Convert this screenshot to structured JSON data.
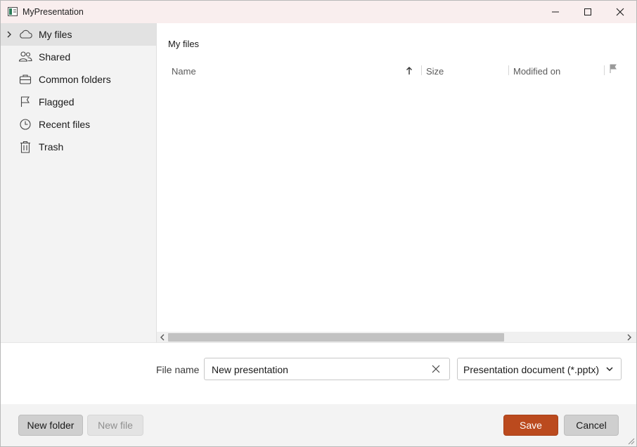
{
  "window": {
    "title": "MyPresentation"
  },
  "sidebar": {
    "items": [
      {
        "label": "My files",
        "icon": "cloud-icon",
        "selected": true,
        "expandable": true
      },
      {
        "label": "Shared",
        "icon": "people-icon",
        "selected": false
      },
      {
        "label": "Common folders",
        "icon": "briefcase-icon",
        "selected": false
      },
      {
        "label": "Flagged",
        "icon": "flag-icon",
        "selected": false
      },
      {
        "label": "Recent files",
        "icon": "clock-icon",
        "selected": false
      },
      {
        "label": "Trash",
        "icon": "trash-icon",
        "selected": false
      }
    ]
  },
  "main": {
    "breadcrumb": "My files",
    "columns": {
      "name": "Name",
      "size": "Size",
      "modified": "Modified on"
    },
    "sort": {
      "column": "Name",
      "direction": "ascending"
    }
  },
  "footer": {
    "file_name_label": "File name",
    "file_name_value": "New presentation",
    "file_type": "Presentation document (*.pptx)",
    "new_folder_label": "New folder",
    "new_file_label": "New file",
    "save_label": "Save",
    "cancel_label": "Cancel"
  },
  "colors": {
    "accent": "#bb4a1e",
    "sidebar_bg": "#f3f3f3",
    "selected_bg": "#e2e2e2",
    "titlebar_bg": "#f9eeee"
  }
}
